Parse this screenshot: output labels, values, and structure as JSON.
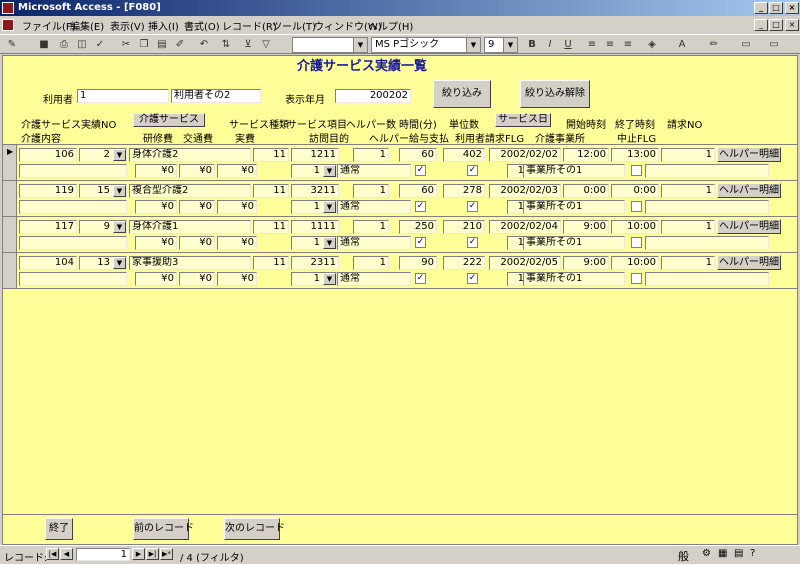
{
  "window": {
    "title": "Microsoft Access - [F080]"
  },
  "menu": [
    "ファイル(F)",
    "編集(E)",
    "表示(V)",
    "挿入(I)",
    "書式(O)",
    "レコード(R)",
    "ツール(T)",
    "ウィンドウ(W)",
    "ヘルプ(H)"
  ],
  "toolbar": {
    "font_name": "MS Pゴシック",
    "font_size": "9",
    "bold": "B",
    "italic": "I",
    "underline": "U"
  },
  "form": {
    "title": "介護サービス実績一覧",
    "filter": {
      "user_label": "利用者",
      "user_id": "1",
      "user_name": "利用者その2",
      "month_label": "表示年月",
      "month_value": "200202",
      "filter_button": "絞り込み",
      "clear_button": "絞り込み解除"
    },
    "headers": {
      "service_no": "介護サービス実績NO",
      "service_button": "介護サービス",
      "service_type": "サービス種類",
      "service_item": "サービス項目",
      "helpers": "ヘルパー数",
      "hours": "時間(分)",
      "units": "単位数",
      "service_date_button": "サービス日",
      "start_time": "開始時刻",
      "end_time": "終了時刻",
      "billing_no": "請求NO",
      "care_content": "介護内容",
      "training_fee": "研修費",
      "transport_fee": "交通費",
      "actual_cost": "実費",
      "visit_purpose": "訪問目的",
      "helper_pay": "ヘルパー給与支払",
      "user_billing_flg": "利用者請求FLG",
      "care_office": "介護事業所",
      "cancel_flg": "中止FLG"
    },
    "records": [
      {
        "no": "106",
        "service": "2",
        "service_name": "身体介護2",
        "type": "11",
        "item": "1211",
        "helpers": "1",
        "hours": "60",
        "units": "402",
        "date": "2002/02/02",
        "start": "12:00",
        "end": "13:00",
        "billing": "1",
        "detail_button": "ヘルパー明細",
        "training": "¥0",
        "transport": "¥0",
        "actual": "¥0",
        "purpose_code": "1",
        "purpose_name": "通常",
        "helper_pay": true,
        "billing_flg": true,
        "office_code": "1",
        "office_name": "事業所その1",
        "cancel": false
      },
      {
        "no": "119",
        "service": "15",
        "service_name": "複合型介護2",
        "type": "11",
        "item": "3211",
        "helpers": "1",
        "hours": "60",
        "units": "278",
        "date": "2002/02/03",
        "start": "0:00",
        "end": "0:00",
        "billing": "1",
        "detail_button": "ヘルパー明細",
        "training": "¥0",
        "transport": "¥0",
        "actual": "¥0",
        "purpose_code": "1",
        "purpose_name": "通常",
        "helper_pay": true,
        "billing_flg": true,
        "office_code": "1",
        "office_name": "事業所その1",
        "cancel": false
      },
      {
        "no": "117",
        "service": "9",
        "service_name": "身体介護1",
        "type": "11",
        "item": "1111",
        "helpers": "1",
        "hours": "250",
        "units": "210",
        "date": "2002/02/04",
        "start": "9:00",
        "end": "10:00",
        "billing": "1",
        "detail_button": "ヘルパー明細",
        "training": "¥0",
        "transport": "¥0",
        "actual": "¥0",
        "purpose_code": "1",
        "purpose_name": "通常",
        "helper_pay": true,
        "billing_flg": true,
        "office_code": "1",
        "office_name": "事業所その1",
        "cancel": false
      },
      {
        "no": "104",
        "service": "13",
        "service_name": "家事援助3",
        "type": "11",
        "item": "2311",
        "helpers": "1",
        "hours": "90",
        "units": "222",
        "date": "2002/02/05",
        "start": "9:00",
        "end": "10:00",
        "billing": "1",
        "detail_button": "ヘルパー明細",
        "training": "¥0",
        "transport": "¥0",
        "actual": "¥0",
        "purpose_code": "1",
        "purpose_name": "通常",
        "helper_pay": true,
        "billing_flg": true,
        "office_code": "1",
        "office_name": "事業所その1",
        "cancel": false
      }
    ],
    "footer": {
      "close_button": "終了",
      "prev_button": "前のレコード",
      "next_button": "次のレコード"
    }
  },
  "status": {
    "record_label": "レコード:",
    "current_record": "1",
    "total": "/ 4 (フィルタ)",
    "ime": "般"
  }
}
